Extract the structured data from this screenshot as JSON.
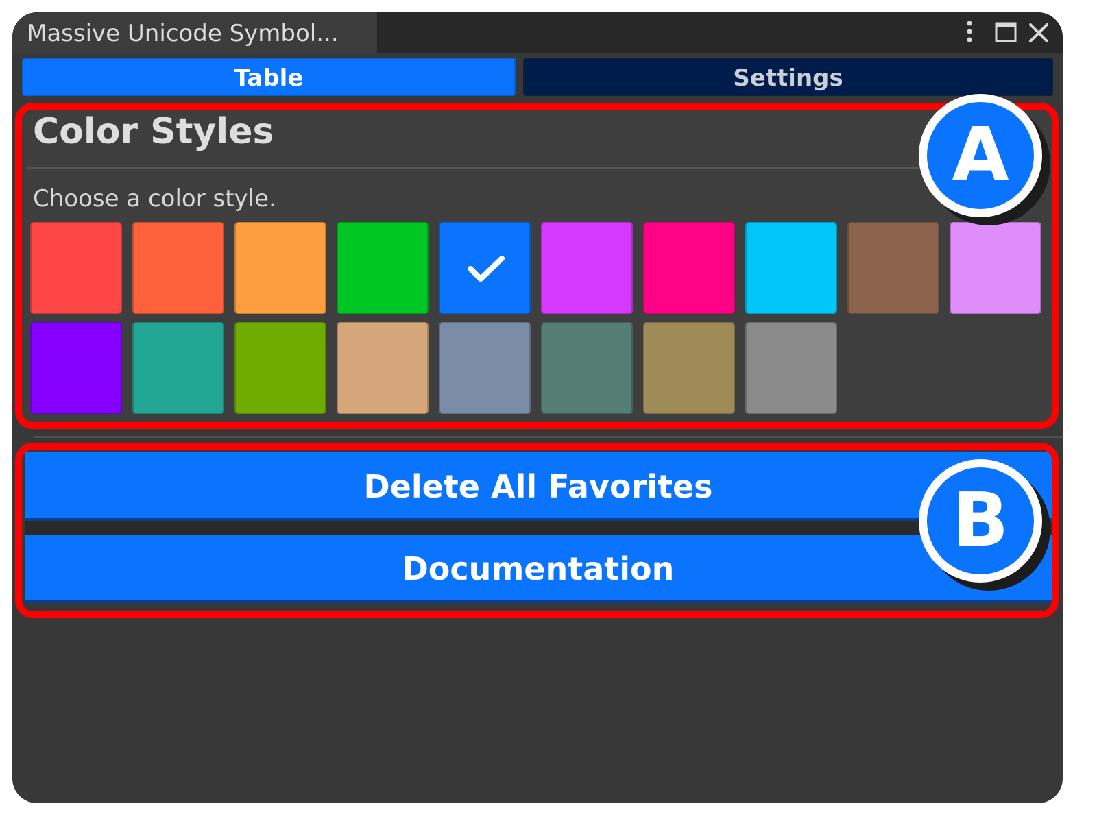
{
  "window": {
    "tab_title": "Massive Unicode Symbol..."
  },
  "tabs": [
    {
      "label": "Table",
      "active": true
    },
    {
      "label": "Settings",
      "active": false
    }
  ],
  "color_styles": {
    "title": "Color Styles",
    "subtitle": "Choose a color style.",
    "selected_index": 4,
    "swatches": [
      "#ff4646",
      "#ff623b",
      "#ff9e3f",
      "#00c724",
      "#0a74ff",
      "#d639ff",
      "#ff0286",
      "#00c6f7",
      "#8b634c",
      "#df8dfb",
      "#8600ff",
      "#21a794",
      "#6ead00",
      "#d5a67a",
      "#7c8ca7",
      "#547d73",
      "#9f8b55",
      "#8a8a8a"
    ]
  },
  "buttons": {
    "delete_favorites": "Delete All Favorites",
    "documentation": "Documentation"
  },
  "callouts": {
    "a": "A",
    "b": "B"
  },
  "colors": {
    "accent": "#0a74ff",
    "callout_frame": "#ff0000",
    "settings_tab": "#001c4a"
  }
}
